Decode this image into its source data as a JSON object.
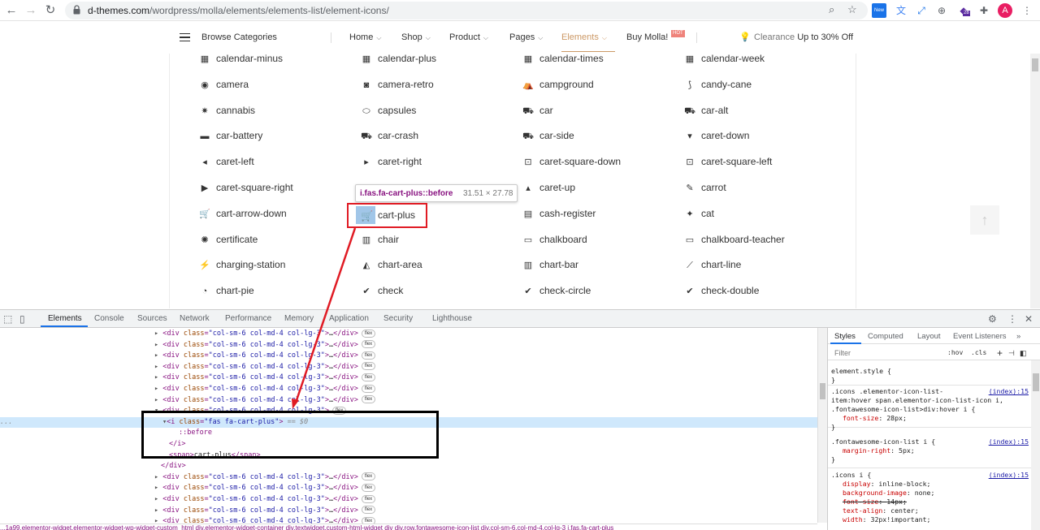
{
  "browser": {
    "url_domain": "d-themes.com",
    "url_path": "/wordpress/molla/elements/elements-list/element-icons/",
    "ext_badge_new": "New",
    "ext_badge_count": "28",
    "avatar_letter": "A"
  },
  "site_header": {
    "browse_label": "Browse Categories",
    "menu": [
      {
        "label": "Home",
        "chevron": "⌵"
      },
      {
        "label": "Shop",
        "chevron": "⌵"
      },
      {
        "label": "Product",
        "chevron": "⌵"
      },
      {
        "label": "Pages",
        "chevron": "⌵"
      },
      {
        "label": "Elements",
        "chevron": "⌵"
      },
      {
        "label": "Buy Molla!",
        "chevron": ""
      }
    ],
    "hot_badge": "HOT",
    "clearance_text": "Clearance",
    "clearance_bold": "Up to 30% Off",
    "accent_color": "#cc9966"
  },
  "icons": [
    [
      {
        "name": "calendar-minus",
        "glyph": "▦"
      },
      {
        "name": "calendar-plus",
        "glyph": "▦"
      },
      {
        "name": "calendar-times",
        "glyph": "▦"
      },
      {
        "name": "calendar-week",
        "glyph": "▦"
      }
    ],
    [
      {
        "name": "camera",
        "glyph": "◉"
      },
      {
        "name": "camera-retro",
        "glyph": "◙"
      },
      {
        "name": "campground",
        "glyph": "⛺"
      },
      {
        "name": "candy-cane",
        "glyph": "⟆"
      }
    ],
    [
      {
        "name": "cannabis",
        "glyph": "✷"
      },
      {
        "name": "capsules",
        "glyph": "⬭"
      },
      {
        "name": "car",
        "glyph": "⛟"
      },
      {
        "name": "car-alt",
        "glyph": "⛟"
      }
    ],
    [
      {
        "name": "car-battery",
        "glyph": "▬"
      },
      {
        "name": "car-crash",
        "glyph": "⛟"
      },
      {
        "name": "car-side",
        "glyph": "⛟"
      },
      {
        "name": "caret-down",
        "glyph": "▾"
      }
    ],
    [
      {
        "name": "caret-left",
        "glyph": "◂"
      },
      {
        "name": "caret-right",
        "glyph": "▸"
      },
      {
        "name": "caret-square-down",
        "glyph": "⊡"
      },
      {
        "name": "caret-square-left",
        "glyph": "⊡"
      }
    ],
    [
      {
        "name": "caret-square-right",
        "glyph": "▶"
      },
      {
        "name": "",
        "glyph": ""
      },
      {
        "name": "caret-up",
        "glyph": "▴"
      },
      {
        "name": "carrot",
        "glyph": "✎"
      }
    ],
    [
      {
        "name": "cart-arrow-down",
        "glyph": "🛒"
      },
      {
        "name": "cart-plus",
        "glyph": ""
      },
      {
        "name": "cash-register",
        "glyph": "▤"
      },
      {
        "name": "cat",
        "glyph": "✦"
      }
    ],
    [
      {
        "name": "certificate",
        "glyph": "✺"
      },
      {
        "name": "chair",
        "glyph": "▥"
      },
      {
        "name": "chalkboard",
        "glyph": "▭"
      },
      {
        "name": "chalkboard-teacher",
        "glyph": "▭"
      }
    ],
    [
      {
        "name": "charging-station",
        "glyph": "⚡"
      },
      {
        "name": "chart-area",
        "glyph": "◭"
      },
      {
        "name": "chart-bar",
        "glyph": "▥"
      },
      {
        "name": "chart-line",
        "glyph": "⟋"
      }
    ],
    [
      {
        "name": "chart-pie",
        "glyph": "◔"
      },
      {
        "name": "check",
        "glyph": "✔"
      },
      {
        "name": "check-circle",
        "glyph": "✔"
      },
      {
        "name": "check-double",
        "glyph": "✔"
      }
    ]
  ],
  "tooltip": {
    "selector": "i.fas.fa-cart-plus::before",
    "size": "31.51 × 27.78"
  },
  "devtools": {
    "tabs": [
      "Elements",
      "Console",
      "Sources",
      "Network",
      "Performance",
      "Memory",
      "Application",
      "Security",
      "Lighthouse"
    ],
    "dom": {
      "div_tag": "div",
      "class_attr": "class",
      "col_class": "\"col-sm-6 col-md-4 col-lg-3\"",
      "ellipsis": "…",
      "close_div": "</div>",
      "flex_badge": "flex",
      "i_class": "\"fas fa-cart-plus\"",
      "eq_marker": "== $0",
      "before": "::before",
      "close_i": "</i>",
      "span_text": "cart-plus",
      "row_dots": "..."
    },
    "breadcrumbs": "...1a99.elementor-widget.elementor-widget-wp-widget-custom_html   div.elementor-widget-container   div.textwidget.custom-html-widget   div   div.row.fontawesome-icon-list   div.col-sm-6.col-md-4.col-lg-3   i.fas.fa-cart-plus",
    "styles_tabs": [
      "Styles",
      "Computed",
      "Layout",
      "Event Listeners"
    ],
    "filter_placeholder": "Filter",
    "hov": ":hov",
    "cls": ".cls",
    "rules": {
      "element_style": "element.style {",
      "close": "}",
      "r1_sel1": ".icons .elementor-icon-list-",
      "r1_sel2": "item:hover span.elementor-icon-list-icon i,",
      "r1_sel3": ".fontawesome-icon-list>div:hover i {",
      "r1_src": "(index):15",
      "r1_prop": "font-size",
      "r1_val": "28px;",
      "r2_sel": ".fontawesome-icon-list i {",
      "r2_src": "(index):15",
      "r2_prop": "margin-right",
      "r2_val": "5px;",
      "r3_sel": ".icons i {",
      "r3_src": "(index):15",
      "r3_p1": "display",
      "r3_v1": "inline-block;",
      "r3_p2": "background-image",
      "r3_v2": "none;",
      "r3_p3": "font-size",
      "r3_v3": "14px;",
      "r3_p4": "text-align",
      "r3_v4": "center;",
      "r3_p5": "width",
      "r3_v5": "32px!important;"
    }
  }
}
